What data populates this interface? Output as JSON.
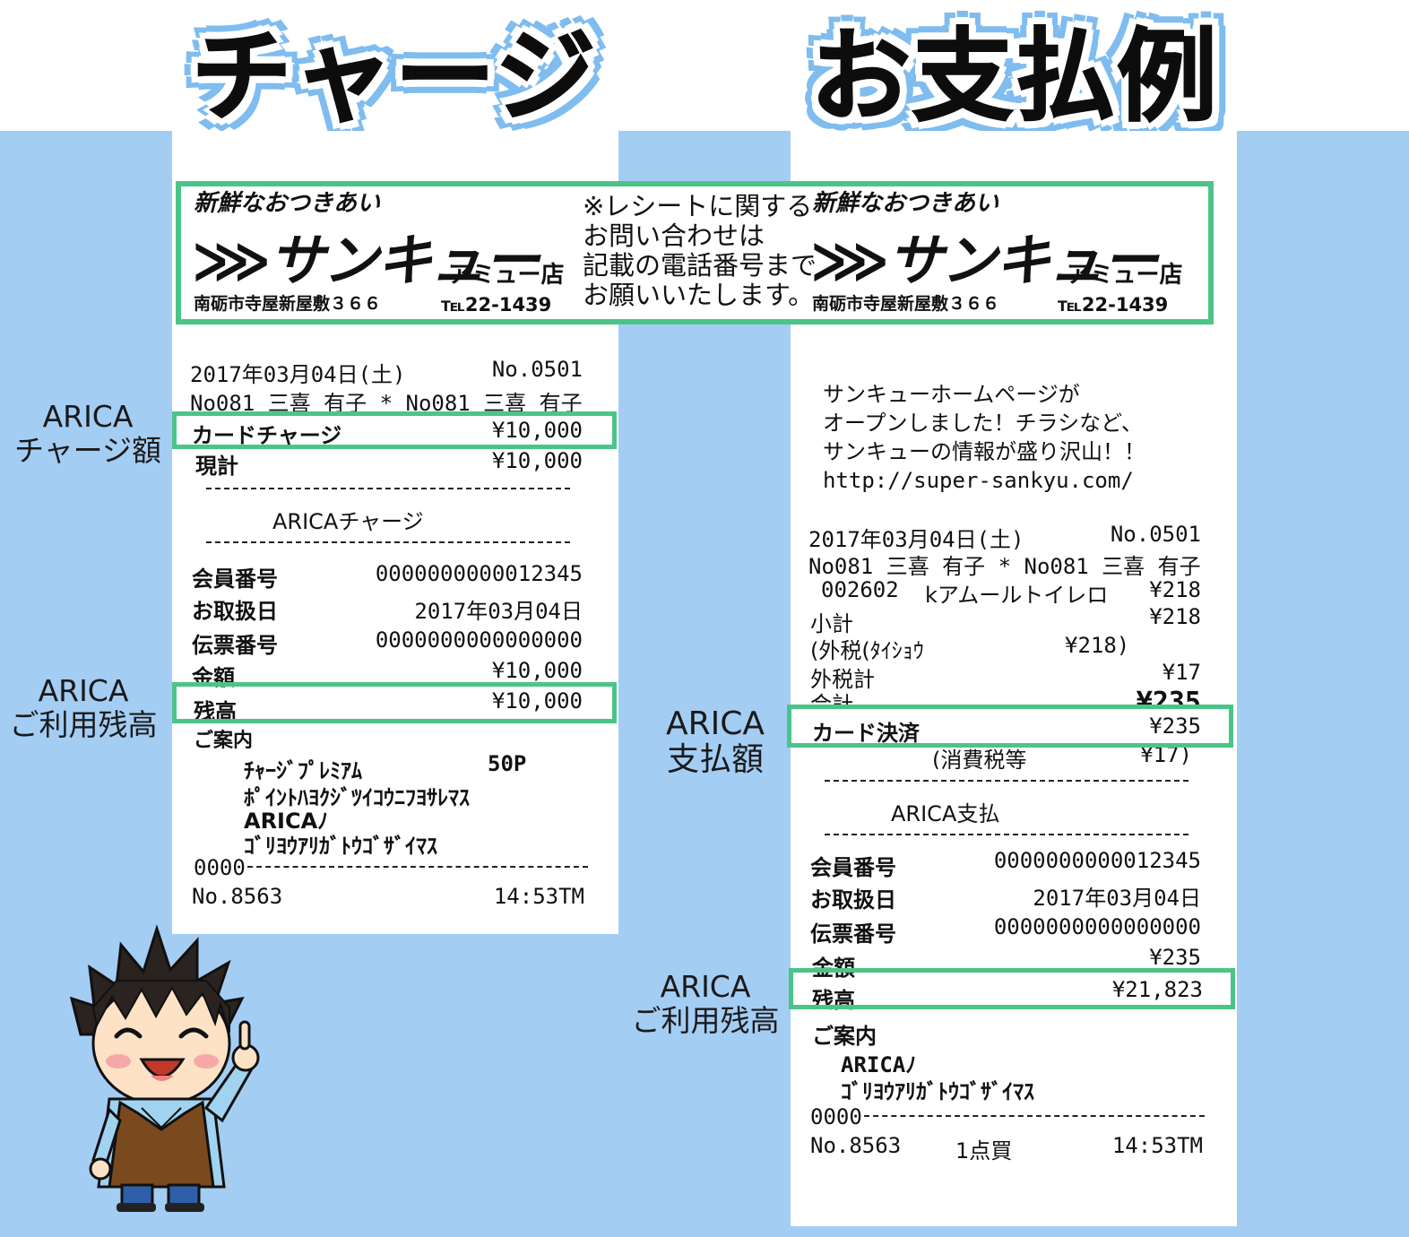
{
  "headings": {
    "charge": "チャージ例",
    "payment": "お支払例"
  },
  "store": {
    "tagline": "新鮮なおつきあい",
    "logo": "サンキュー",
    "branch": "アミュー店",
    "address": "南砺市寺屋新屋敷３６６",
    "tel": "℡22-1439",
    "notice": [
      "※レシートに関する",
      "お問い合わせは",
      "記載の電話番号まで",
      "お願いいたします。"
    ]
  },
  "side_labels": {
    "charge_amount": [
      "ARICA",
      "チャージ額"
    ],
    "charge_balance": [
      "ARICA",
      "ご利用残高"
    ],
    "payment_amount": [
      "ARICA",
      "支払額"
    ],
    "payment_balance": [
      "ARICA",
      "ご利用残高"
    ]
  },
  "charge_receipt": {
    "date": "2017年03月04日(土)",
    "number": "No.0501",
    "clerk": "No081 三喜 有子  * No081 三喜 有子",
    "card_charge_label": "カードチャージ",
    "card_charge_value": "¥10,000",
    "total_label": "現計",
    "total_value": "¥10,000",
    "section_title": "ARICAチャージ",
    "rows": [
      {
        "label": "会員番号",
        "value": "0000000000012345"
      },
      {
        "label": "お取扱日",
        "value": "2017年03月04日"
      },
      {
        "label": "伝票番号",
        "value": "0000000000000000"
      },
      {
        "label": "金額",
        "value": "¥10,000"
      }
    ],
    "balance_label": "残高",
    "balance_value": "¥10,000",
    "guide_label": "ご案内",
    "guide_lines": [
      "ﾁｬｰｼﾞﾌﾟﾚﾐｱﾑ",
      "ﾎﾟｲﾝﾄﾊﾖｸｼﾞﾂｲｺｳﾆﾌﾖｻﾚﾏｽ",
      "ARICAﾉ",
      "ｺﾞﾘﾖｳｱﾘｶﾞﾄｳｺﾞｻﾞｲﾏｽ"
    ],
    "premium_points": "50P",
    "footer_code": "0000",
    "footer_no": "No.8563",
    "footer_time": "14:53TM"
  },
  "payment_receipt": {
    "promo": [
      "サンキューホームページが",
      "オープンしました！チラシなど、",
      "サンキューの情報が盛り沢山！！",
      "http://super-sankyu.com/"
    ],
    "date": "2017年03月04日(土)",
    "number": "No.0501",
    "clerk": "No081 三喜 有子  * No081 三喜 有子",
    "item_code": "002602",
    "item_name": "kアムールトイレロ",
    "item_price": "¥218",
    "subtotal_label": "小計",
    "subtotal_value": "¥218",
    "tax_base_label": "(外税(ﾀｲｼｮｳ",
    "tax_base_value": "¥218)",
    "tax_label": "外税計",
    "tax_value": "¥17",
    "total_label": "合計",
    "total_value": "¥235",
    "card_pay_label": "カード決済",
    "card_pay_value": "¥235",
    "consumption_tax_label": "(消費税等",
    "consumption_tax_value": "¥17)",
    "section_title": "ARICA支払",
    "rows": [
      {
        "label": "会員番号",
        "value": "0000000000012345"
      },
      {
        "label": "お取扱日",
        "value": "2017年03月04日"
      },
      {
        "label": "伝票番号",
        "value": "0000000000000000"
      },
      {
        "label": "金額",
        "value": "¥235"
      }
    ],
    "balance_label": "残高",
    "balance_value": "¥21,823",
    "guide_label": "ご案内",
    "guide_lines": [
      "ARICAﾉ",
      "ｺﾞﾘﾖｳｱﾘｶﾞﾄｳｺﾞｻﾞｲﾏｽ"
    ],
    "footer_code": "0000",
    "footer_no": "No.8563",
    "footer_count": "1点買",
    "footer_time": "14:53TM"
  },
  "colors": {
    "background": "#a4cdf4",
    "highlight": "#4bc488",
    "heading_outline": "#7fbcef"
  }
}
